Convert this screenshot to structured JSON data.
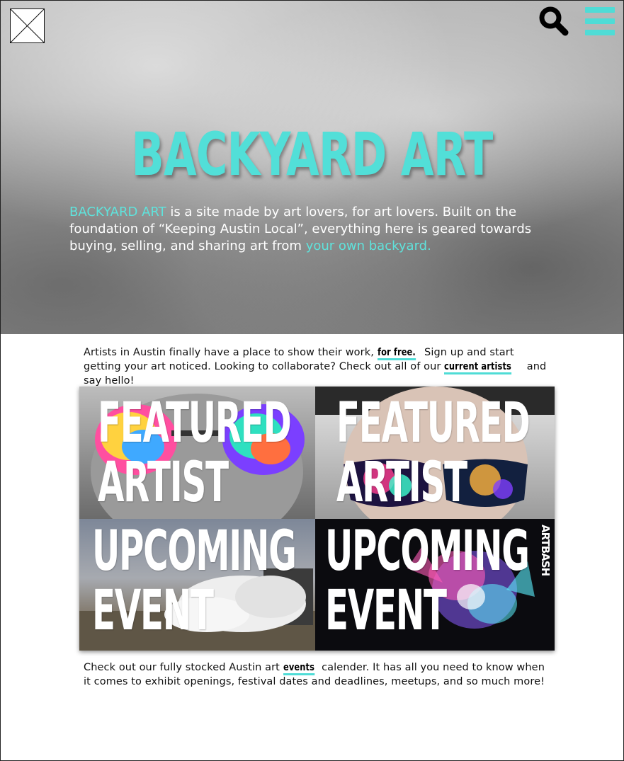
{
  "header": {
    "logo_icon": "image-placeholder-icon",
    "search_icon": "search-icon",
    "menu_icon": "hamburger-menu-icon",
    "accent_color": "#4fdcd6"
  },
  "hero": {
    "title": "BACKYARD ART",
    "text_brand": "BACKYARD ART",
    "text_body": " is a site made by art lovers, for art lovers. Built on the foundation of “Keeping Austin Local”, everything here is geared towards buying, selling, and sharing art from ",
    "text_link": "your own backyard."
  },
  "intro": {
    "part1": "Artists in Austin finally have a place to show their work, ",
    "link_free": "for free.",
    "part2": " Sign up and start getting your art noticed. Looking to collaborate? Check out all of our ",
    "link_artists": "current artists",
    "part3": " and say hello!"
  },
  "tiles": [
    {
      "line1": "FEATURED",
      "line2": "ARTIST"
    },
    {
      "line1": "FEATURED",
      "line2": "ARTIST"
    },
    {
      "line1": "UPCOMING",
      "line2": "EVENT"
    },
    {
      "line1": "UPCOMING",
      "line2": "EVENT",
      "badge": "ARTBASH"
    }
  ],
  "outro": {
    "part1": "Check out our fully stocked Austin art ",
    "link_events": "events",
    "part2": " calender. It has all you need to know when it comes to exhibit openings, festival dates and deadlines, meetups, and so much more!"
  }
}
